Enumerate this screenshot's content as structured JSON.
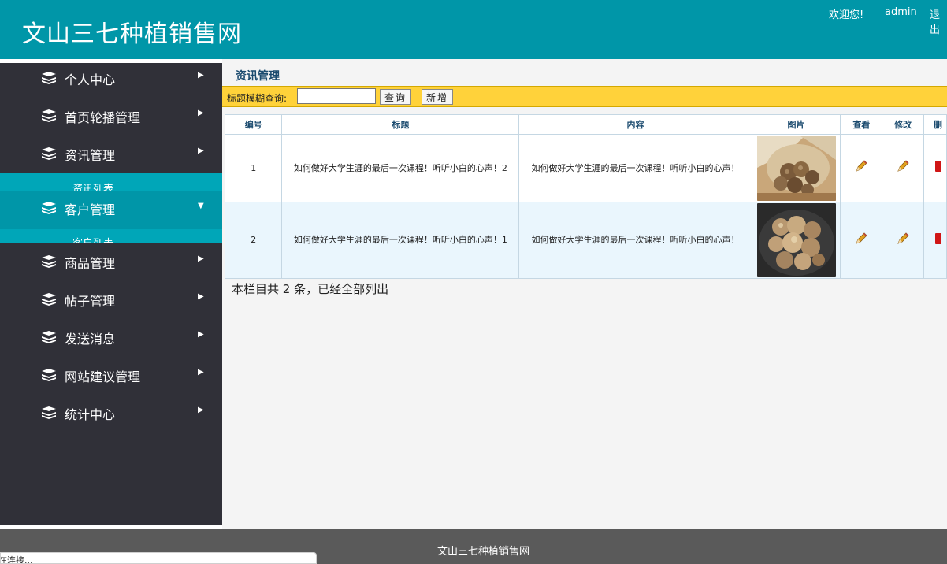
{
  "header": {
    "site_title": "文山三七种植销售网",
    "welcome_text": "欢迎您!",
    "username": "admin",
    "logout_label": "退出"
  },
  "sidebar": {
    "items": [
      {
        "label": "个人中心",
        "icon": "stack-icon",
        "expanded": false
      },
      {
        "label": "首页轮播管理",
        "icon": "stack-icon",
        "expanded": false
      },
      {
        "label": "资讯管理",
        "icon": "stack-icon",
        "expanded": true,
        "children": [
          {
            "label": "资讯列表"
          }
        ]
      },
      {
        "label": "客户管理",
        "icon": "stack-icon",
        "expanded": true,
        "children": [
          {
            "label": "客户列表"
          }
        ]
      },
      {
        "label": "商品管理",
        "icon": "stack-icon",
        "expanded": false
      },
      {
        "label": "帖子管理",
        "icon": "stack-icon",
        "expanded": false
      },
      {
        "label": "发送消息",
        "icon": "stack-icon",
        "expanded": false
      },
      {
        "label": "网站建议管理",
        "icon": "stack-icon",
        "expanded": false
      },
      {
        "label": "统计中心",
        "icon": "stack-icon",
        "expanded": false
      }
    ]
  },
  "main": {
    "title": "资讯管理",
    "search": {
      "label": "标题模糊查询:",
      "value": "",
      "placeholder": "",
      "query_button": "查询",
      "add_button": "新增"
    },
    "table": {
      "columns": [
        "编号",
        "标题",
        "内容",
        "图片",
        "查看",
        "修改",
        "删"
      ],
      "rows": [
        {
          "id": "1",
          "title": "如何做好大学生涯的最后一次课程！听听小白的心声！2",
          "content": "如何做好大学生涯的最后一次课程！听听小白的心声！",
          "image": "sanqi-root-in-sack"
        },
        {
          "id": "2",
          "title": "如何做好大学生涯的最后一次课程！听听小白的心声！1",
          "content": "如何做好大学生涯的最后一次课程！听听小白的心声！",
          "image": "sanqi-root-on-plate"
        }
      ]
    },
    "summary": "本栏目共 2 条，已经全部列出"
  },
  "footer": {
    "text": "文山三七种植销售网"
  },
  "status_bar": {
    "text": "正在连接..."
  },
  "colors": {
    "header_bg": "#0096a8",
    "sidebar_bg": "#303038",
    "sidebar_active": "#0096a8",
    "search_bar_bg": "#ffd23a",
    "table_header_text": "#1a4a6e",
    "row_alt_bg": "#eaf6fd",
    "footer_bg": "#5a5a5a"
  }
}
